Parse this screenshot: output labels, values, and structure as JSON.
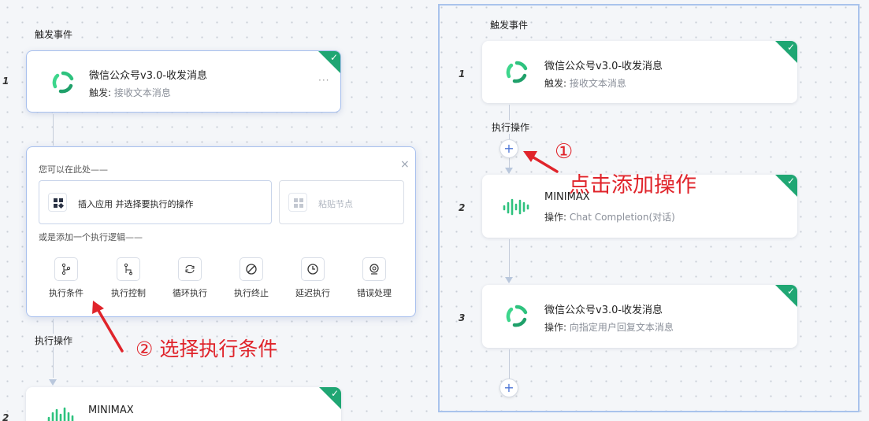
{
  "left": {
    "trigger_label": "触发事件",
    "steps": [
      {
        "num": "1",
        "title": "微信公众号v3.0-收发消息",
        "sub_key": "触发:",
        "sub_val": "接收文本消息",
        "more": "···"
      },
      {
        "num": "2",
        "title": "MINIMAX"
      }
    ],
    "exec_label": "执行操作",
    "panel": {
      "hint": "您可以在此处——",
      "insert_label": "插入应用 并选择要执行的操作",
      "paste_label": "粘贴节点",
      "logic_hint": "或是添加一个执行逻辑——",
      "close": "×",
      "logic_items": [
        {
          "label": "执行条件",
          "icon": "branch-icon"
        },
        {
          "label": "执行控制",
          "icon": "control-icon"
        },
        {
          "label": "循环执行",
          "icon": "loop-icon"
        },
        {
          "label": "执行终止",
          "icon": "stop-icon"
        },
        {
          "label": "延迟执行",
          "icon": "clock-icon"
        },
        {
          "label": "错误处理",
          "icon": "error-icon"
        }
      ]
    }
  },
  "right": {
    "trigger_label": "触发事件",
    "exec_label": "执行操作",
    "steps": [
      {
        "num": "1",
        "title": "微信公众号v3.0-收发消息",
        "sub_key": "触发:",
        "sub_val": "接收文本消息"
      },
      {
        "num": "2",
        "title": "MINIMAX",
        "sub_key": "操作:",
        "sub_val": "Chat Completion(对话)"
      },
      {
        "num": "3",
        "title": "微信公众号v3.0-收发消息",
        "sub_key": "操作:",
        "sub_val": "向指定用户回复文本消息"
      }
    ],
    "plus": "+"
  },
  "annotations": {
    "a1_num": "①",
    "a1_text": "点击添加操作",
    "a2_text": "② 选择执行条件"
  },
  "colors": {
    "accent": "#1fa673",
    "annotation": "#e0242b",
    "selection": "#a8c0ee"
  }
}
